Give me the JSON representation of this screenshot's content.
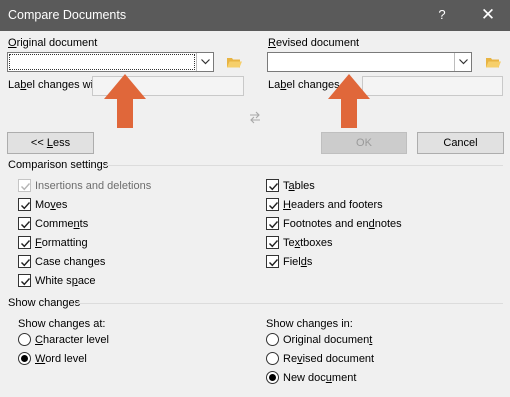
{
  "window": {
    "title": "Compare Documents",
    "help_label": "?",
    "close_label": "✕"
  },
  "original": {
    "label_pre": "",
    "label_key": "O",
    "label_post": "riginal document",
    "value": "",
    "label_changes_pre": "La",
    "label_changes_key": "b",
    "label_changes_post": "el changes with",
    "label_changes_value": ""
  },
  "revised": {
    "label_pre": "",
    "label_key": "R",
    "label_post": "evised document",
    "value": "",
    "label_changes_pre": "La",
    "label_changes_key": "b",
    "label_changes_post": "el changes",
    "label_changes_value": ""
  },
  "buttons": {
    "less_pre": "<< ",
    "less_key": "L",
    "less_post": "ess",
    "ok": "OK",
    "cancel": "Cancel"
  },
  "comparison": {
    "header": "Comparison settings",
    "items": [
      {
        "pre": "Insertions and deletions",
        "key": "",
        "post": "",
        "checked": true,
        "disabled": true
      },
      {
        "pre": "Mo",
        "key": "v",
        "post": "es",
        "checked": true,
        "disabled": false
      },
      {
        "pre": "Comme",
        "key": "n",
        "post": "ts",
        "checked": true,
        "disabled": false
      },
      {
        "pre": "",
        "key": "F",
        "post": "ormatting",
        "checked": true,
        "disabled": false
      },
      {
        "pre": "Case chan",
        "key": "g",
        "post": "es",
        "checked": true,
        "disabled": false
      },
      {
        "pre": "White s",
        "key": "p",
        "post": "ace",
        "checked": true,
        "disabled": false
      },
      {
        "pre": "T",
        "key": "a",
        "post": "bles",
        "checked": true,
        "disabled": false
      },
      {
        "pre": "",
        "key": "H",
        "post": "eaders and footers",
        "checked": true,
        "disabled": false
      },
      {
        "pre": "Footnotes and en",
        "key": "d",
        "post": "notes",
        "checked": true,
        "disabled": false
      },
      {
        "pre": "Te",
        "key": "x",
        "post": "tboxes",
        "checked": true,
        "disabled": false
      },
      {
        "pre": "Fiel",
        "key": "d",
        "post": "s",
        "checked": true,
        "disabled": false
      }
    ]
  },
  "show_changes": {
    "header": "Show changes",
    "at_label": "Show changes at:",
    "in_label": "Show changes in:",
    "at_options": [
      {
        "pre": "",
        "key": "C",
        "post": "haracter level",
        "selected": false
      },
      {
        "pre": "",
        "key": "W",
        "post": "ord level",
        "selected": true
      }
    ],
    "in_options": [
      {
        "pre": "Original documen",
        "key": "t",
        "post": "",
        "selected": false
      },
      {
        "pre": "Re",
        "key": "v",
        "post": "ised document",
        "selected": false
      },
      {
        "pre": "New doc",
        "key": "u",
        "post": "ment",
        "selected": true
      }
    ]
  },
  "colors": {
    "titlebar": "#5a5a5a",
    "arrow": "#e0673a",
    "dialog_bg": "#f0f0f0"
  }
}
